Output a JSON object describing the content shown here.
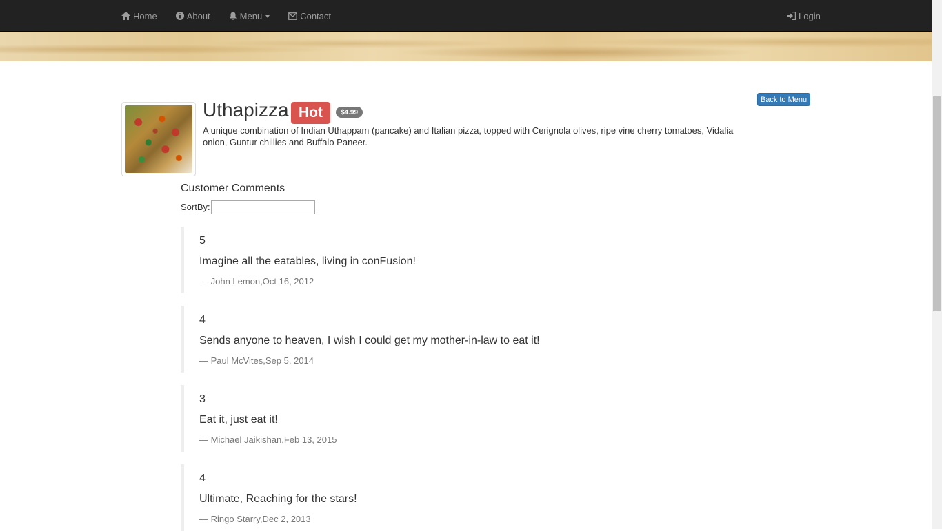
{
  "nav": {
    "home": "Home",
    "about": "About",
    "menu": "Menu",
    "contact": "Contact",
    "login": "Login"
  },
  "dish": {
    "name": "Uthapizza",
    "label": "Hot",
    "price": "$4.99",
    "description": "A unique combination of Indian Uthappam (pancake) and Italian pizza, topped with Cerignola olives, ripe vine cherry tomatoes, Vidalia onion, Guntur chillies and Buffalo Paneer."
  },
  "back_button": "Back to Menu",
  "comments_heading": "Customer Comments",
  "sort": {
    "label": "SortBy:",
    "value": ""
  },
  "comments": [
    {
      "rating": "5",
      "text": "Imagine all the eatables, living in conFusion!",
      "footer": "— John Lemon,Oct 16, 2012"
    },
    {
      "rating": "4",
      "text": "Sends anyone to heaven, I wish I could get my mother-in-law to eat it!",
      "footer": "— Paul McVites,Sep 5, 2014"
    },
    {
      "rating": "3",
      "text": "Eat it, just eat it!",
      "footer": "— Michael Jaikishan,Feb 13, 2015"
    },
    {
      "rating": "4",
      "text": "Ultimate, Reaching for the stars!",
      "footer": "— Ringo Starry,Dec 2, 2013"
    }
  ],
  "colors": {
    "navbar": "#222222",
    "badge_hot": "#d9534f",
    "badge_price": "#777777",
    "button": "#337ab7"
  }
}
